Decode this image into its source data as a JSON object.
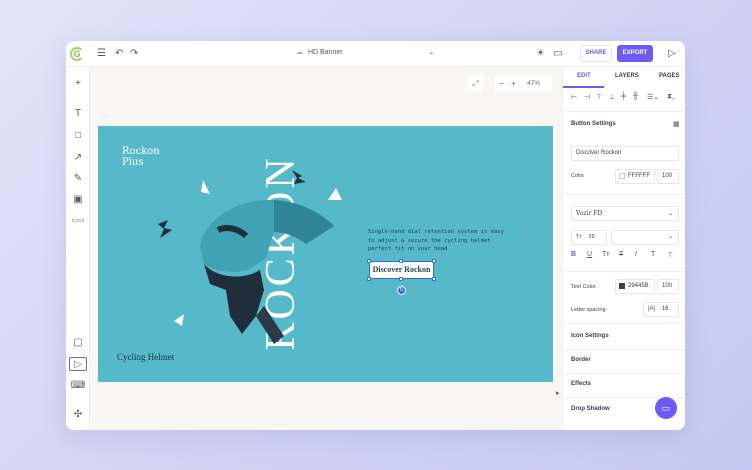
{
  "topbar": {
    "doc_title": "HD Banner",
    "share_label": "SHARE",
    "export_label": "EXPORT"
  },
  "canvas": {
    "zoom": "47%",
    "banner": {
      "brand_line1": "Rockon",
      "brand_line2": "Plus",
      "big_word": "ROCKON",
      "description": "Single-hand dial retention system is easy to adjust & secure the cycling helmet perfect fit on your head",
      "button_label": "Discover Rockon",
      "subtitle": "Cycling Helmet",
      "bg_color": "#55b9ca"
    }
  },
  "right_panel": {
    "tabs": [
      "EDIT",
      "LAYERS",
      "PAGES"
    ],
    "active_tab": "EDIT",
    "button_settings_title": "Button Settings",
    "button_text_value": "Discover Rockon",
    "color_label": "Color",
    "color_hex": "FFFFFF",
    "color_opacity": "100",
    "font_family": "Vazir FD",
    "font_size": "29",
    "text_color_label": "Text Color",
    "text_color_hex": "29445B",
    "text_color_opacity": "100",
    "letter_spacing_label": "Letter spacing",
    "letter_spacing_value": "16",
    "sections": [
      "Icon Settings",
      "Border",
      "Effects",
      "Drop Shadow"
    ]
  },
  "colors": {
    "accent": "#6b5cf6",
    "banner": "#55b9ca",
    "button_text": "#29445b"
  }
}
